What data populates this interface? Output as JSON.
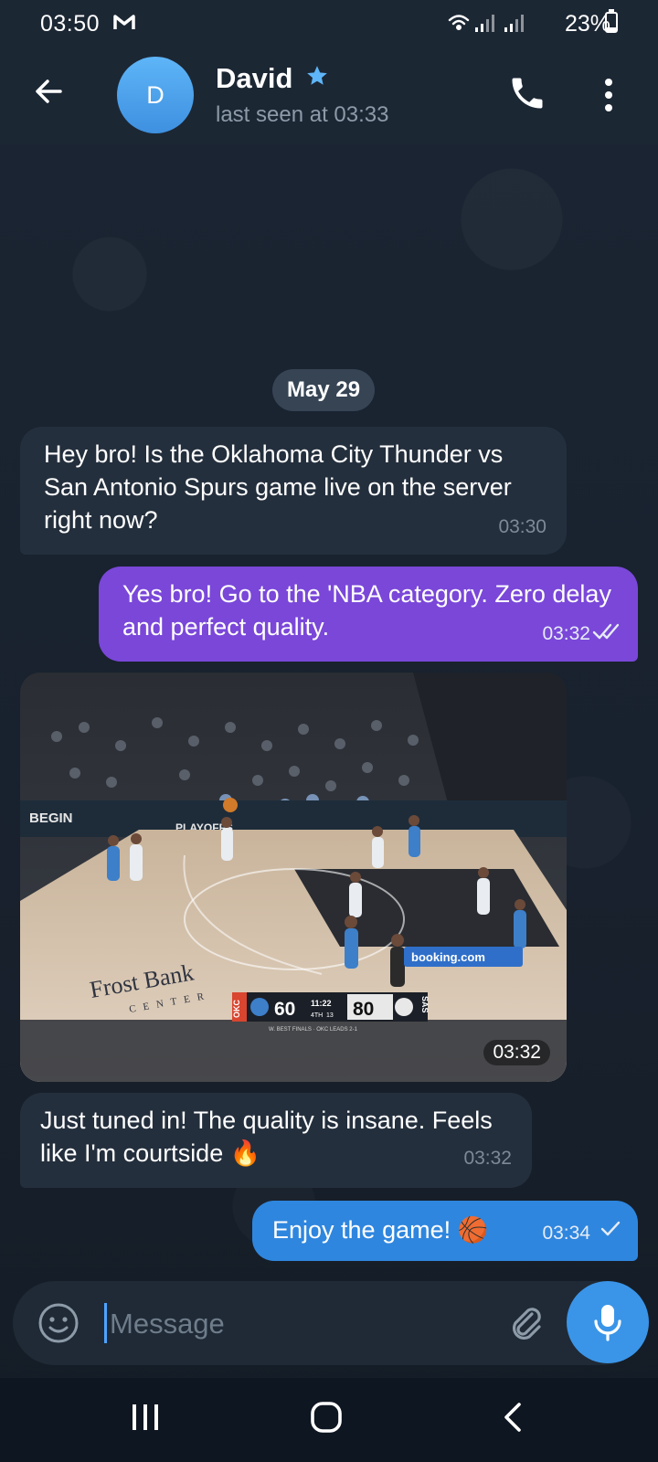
{
  "status_bar": {
    "time": "03:50",
    "battery": "23%",
    "battery_level": 0.23
  },
  "header": {
    "avatar_letter": "D",
    "name": "David",
    "last_seen": "last seen at 03:33"
  },
  "date_separator": "May 29",
  "messages": [
    {
      "text": "Hey bro! Is the Oklahoma City Thunder vs San Antonio Spurs game live on the server right now?",
      "time": "03:30",
      "direction": "incoming"
    },
    {
      "text": "Yes bro! Go to the 'NBA category. Zero delay and perfect quality.",
      "time": "03:32",
      "direction": "outgoing",
      "status": "read"
    },
    {
      "type": "photo",
      "time": "03:32",
      "direction": "incoming",
      "scoreboard": {
        "team1": "OKC",
        "score1": "60",
        "clock": "11:22",
        "period": "4TH",
        "shot_clock": "13",
        "score2": "80",
        "team2": "SAS",
        "series": "W. BEST FINALS · OKC LEADS 2-1"
      },
      "arena_sign": "Frost Bank",
      "arena_sub": "CENTER",
      "banner_left": "BEGIN",
      "banner_right": "PLAYOFFS",
      "sponsor": "booking.com"
    },
    {
      "text": "Just tuned in! The quality is insane. Feels like I'm courtside 🔥",
      "time": "03:32",
      "direction": "incoming"
    },
    {
      "text": "Enjoy the game! 🏀",
      "time": "03:34",
      "direction": "outgoing",
      "status": "sent"
    }
  ],
  "composer": {
    "placeholder": "Message"
  },
  "colors": {
    "header_bg": "#1c2734",
    "incoming_bubble": "#242f3d",
    "outgoing_purple": "#7a47d9",
    "outgoing_blue": "#2f86de",
    "accent": "#3a95e8"
  }
}
